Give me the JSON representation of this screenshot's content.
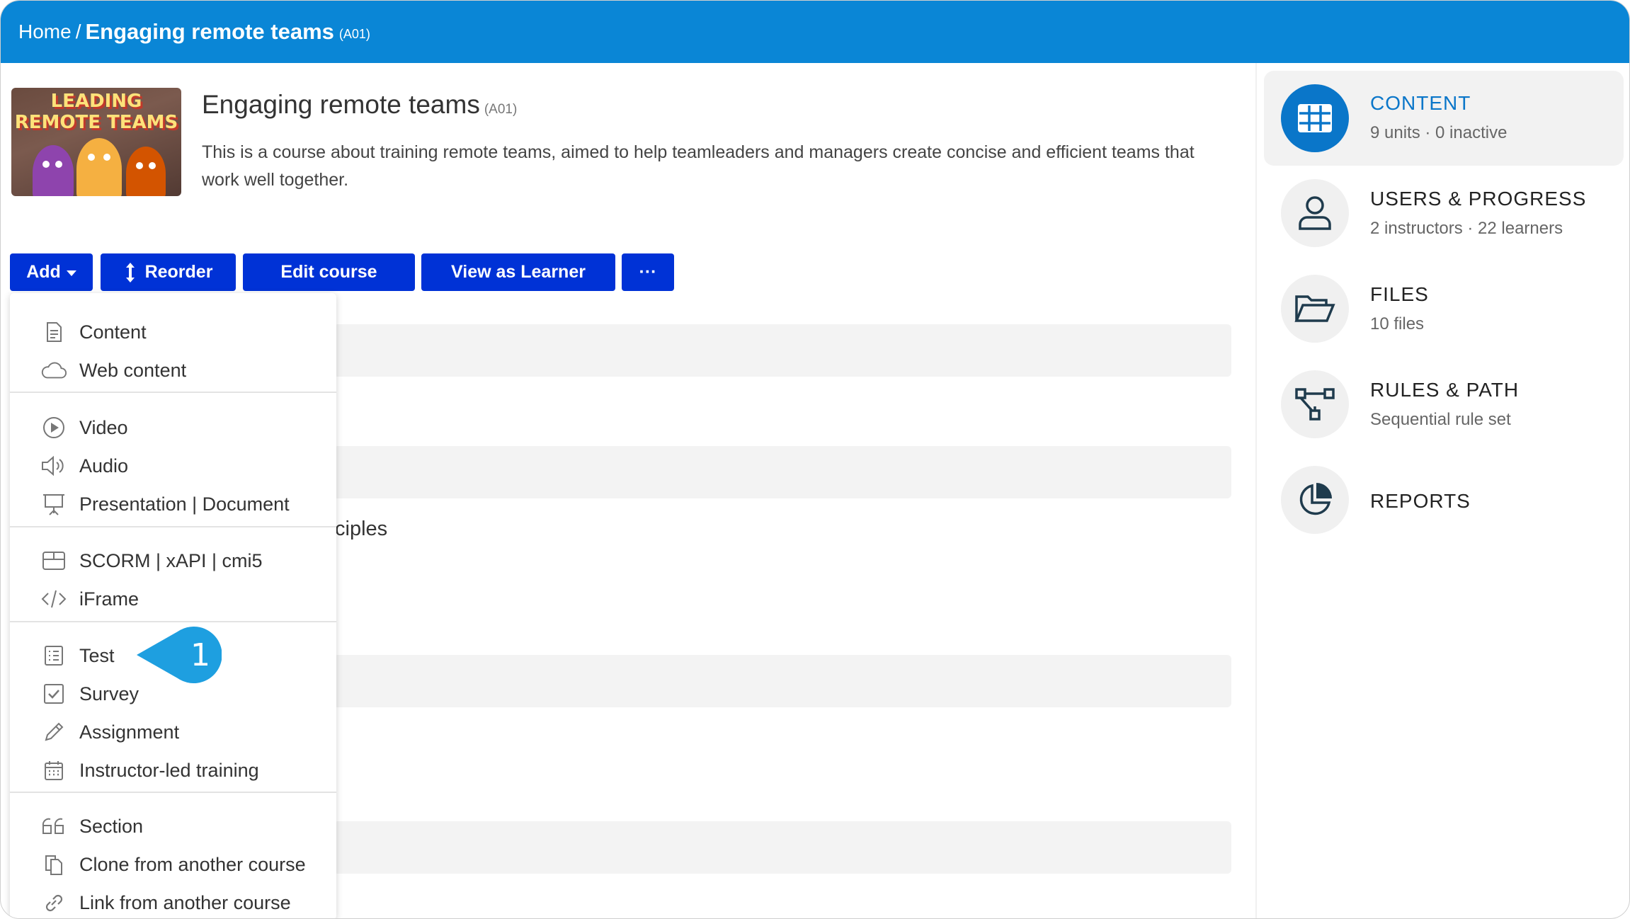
{
  "breadcrumb": {
    "home": "Home",
    "separator": "/",
    "course": "Engaging remote teams",
    "code": "(A01)"
  },
  "course": {
    "title": "Engaging remote teams",
    "code": "(A01)",
    "description": "This is a course about training remote teams, aimed to help teamleaders and managers create concise and efficient teams that work well together.",
    "thumbnail_text": [
      "LEADING",
      "REMOTE TEAMS"
    ]
  },
  "toolbar": {
    "add": "Add",
    "reorder": "Reorder",
    "edit": "Edit course",
    "view": "View as Learner",
    "more": "···"
  },
  "background_text": "ciples",
  "add_menu": {
    "groups": [
      [
        {
          "label": "Content",
          "icon": "document-icon"
        },
        {
          "label": "Web content",
          "icon": "cloud-icon"
        }
      ],
      [
        {
          "label": "Video",
          "icon": "play-icon"
        },
        {
          "label": "Audio",
          "icon": "speaker-icon"
        },
        {
          "label": "Presentation | Document",
          "icon": "presentation-icon"
        }
      ],
      [
        {
          "label": "SCORM | xAPI | cmi5",
          "icon": "package-icon"
        },
        {
          "label": "iFrame",
          "icon": "code-icon"
        }
      ],
      [
        {
          "label": "Test",
          "icon": "checklist-icon"
        },
        {
          "label": "Survey",
          "icon": "checkbox-icon"
        },
        {
          "label": "Assignment",
          "icon": "pencil-icon"
        },
        {
          "label": "Instructor-led training",
          "icon": "calendar-icon"
        }
      ],
      [
        {
          "label": "Section",
          "icon": "quote-icon"
        },
        {
          "label": "Clone from another course",
          "icon": "clone-icon"
        },
        {
          "label": "Link from another course",
          "icon": "link-icon"
        }
      ]
    ]
  },
  "callout": {
    "number": "1"
  },
  "sidebar": {
    "items": [
      {
        "name": "CONTENT",
        "sub": "9 units · 0 inactive",
        "icon": "grid-icon",
        "active": true
      },
      {
        "name": "USERS & PROGRESS",
        "sub": "2 instructors · 22 learners",
        "icon": "user-icon"
      },
      {
        "name": "FILES",
        "sub": "10 files",
        "icon": "folder-open-icon"
      },
      {
        "name": "RULES & PATH",
        "sub": "Sequential rule set",
        "icon": "flow-icon"
      },
      {
        "name": "REPORTS",
        "sub": "",
        "icon": "pie-chart-icon"
      }
    ]
  },
  "colors": {
    "topbar": "#0a86d6",
    "button": "#0032d6",
    "accent": "#0a76c9",
    "callout": "#1e9fe0"
  }
}
